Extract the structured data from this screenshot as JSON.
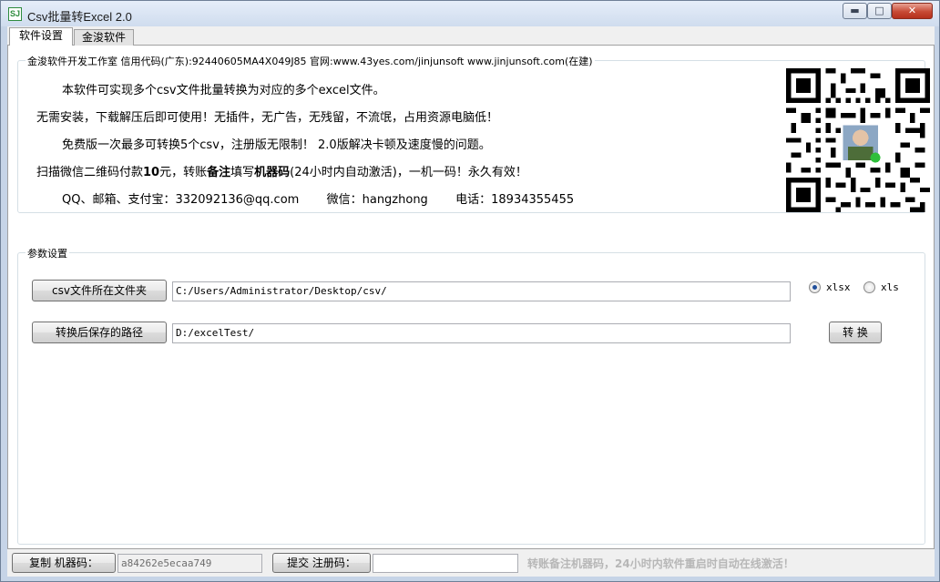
{
  "window": {
    "icon_text": "SJ",
    "title": "Csv批量转Excel 2.0",
    "controls": {
      "minimize": "▬",
      "maximize": "□",
      "close": "✕"
    }
  },
  "tabs": [
    {
      "label": "软件设置",
      "active": true
    },
    {
      "label": "金浚软件",
      "active": false
    }
  ],
  "info": {
    "group_title": "金浚软件开发工作室 信用代码(广东):92440605MA4X049J85 官网:www.43yes.com/jinjunsoft  www.jinjunsoft.com(在建)",
    "line1": "本软件可实现多个csv文件批量转换为对应的多个excel文件。",
    "line2": "无需安装，下载解压后即可使用！无插件，无广告，无残留，不流氓，占用资源电脑低！",
    "line3": "免费版一次最多可转换5个csv，注册版无限制！ 2.0版解决卡顿及速度慢的问题。",
    "line4": {
      "part1": "扫描微信二维码付款",
      "amount": "10",
      "part2": "元，转账",
      "remark": "备注",
      "part3": "填写",
      "machine": "机器码",
      "part4": "(24小时内自动激活)，一机一码！永久有效！"
    },
    "line5": {
      "qq_label": "QQ、邮箱、支付宝：",
      "qq_value": "332092136@qq.com",
      "wechat_label": "微信：",
      "wechat_value": "hangzhong",
      "phone_label": "电话：",
      "phone_value": "18934355455"
    }
  },
  "params": {
    "group_title": "参数设置",
    "source_button": "csv文件所在文件夹",
    "source_path": "C:/Users/Administrator/Desktop/csv/",
    "target_button": "转换后保存的路径",
    "target_path": "D:/excelTest/",
    "format_options": [
      {
        "label": "xlsx",
        "checked": true
      },
      {
        "label": "xls",
        "checked": false
      }
    ],
    "convert_button": "转 换"
  },
  "status": {
    "copy_button": "复制 机器码：",
    "machine_code": "a84262e5ecaa749",
    "submit_button": "提交 注册码：",
    "register_code": "",
    "note": "转账备注机器码，24小时内软件重启时自动在线激活！"
  }
}
